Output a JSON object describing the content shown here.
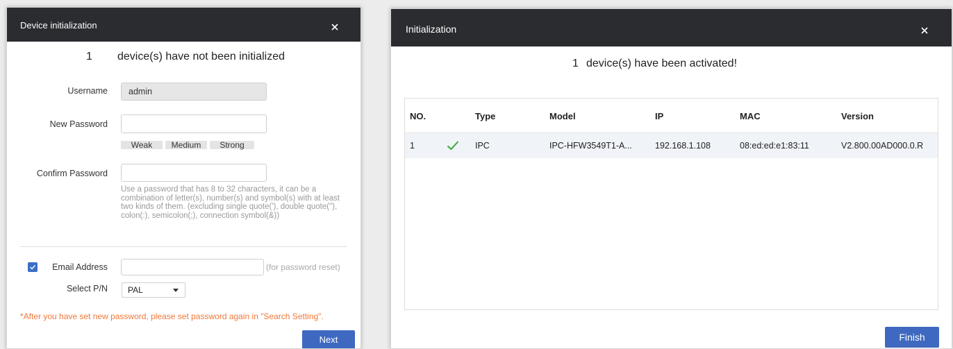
{
  "left_dialog": {
    "title": "Device initialization",
    "count": "1",
    "count_message": "device(s) have not been initialized",
    "username_label": "Username",
    "username_value": "admin",
    "new_password_label": "New Password",
    "new_password_value": "",
    "strength": {
      "weak": "Weak",
      "medium": "Medium",
      "strong": "Strong"
    },
    "confirm_password_label": "Confirm Password",
    "confirm_password_value": "",
    "password_hint": "Use a password that has 8 to 32 characters, it can be a combination of letter(s), number(s) and symbol(s) with at least two kinds of them. (excluding single quote('), double quote(\"), colon(:), semicolon(;), connection symbol(&))",
    "email_checked": true,
    "email_label": "Email Address",
    "email_value": "",
    "email_hint": "(for password reset)",
    "select_pn_label": "Select P/N",
    "select_pn_value": "PAL",
    "warning": "*After you have set new password, please set password again in \"Search Setting\".",
    "next_label": "Next"
  },
  "right_dialog": {
    "title": "Initialization",
    "count": "1",
    "count_message": "device(s) have been activated!",
    "table": {
      "columns": [
        "NO.",
        "Type",
        "Model",
        "IP",
        "MAC",
        "Version"
      ],
      "rows": [
        {
          "no": "1",
          "status": "success",
          "type": "IPC",
          "model": "IPC-HFW3549T1-A...",
          "ip": "192.168.1.108",
          "mac": "08:ed:ed:e1:83:11",
          "version": "V2.800.00AD000.0.R"
        }
      ]
    },
    "finish_label": "Finish"
  },
  "colors": {
    "titlebar": "#2b2c30",
    "accent": "#3f69c0",
    "count": "#e23b3b",
    "warning": "#f07838",
    "check": "#3aa635"
  },
  "icons": {
    "close": "close-icon",
    "check": "check-icon",
    "caret": "caret-down-icon",
    "checkbox": "checkbox-checked-icon"
  }
}
